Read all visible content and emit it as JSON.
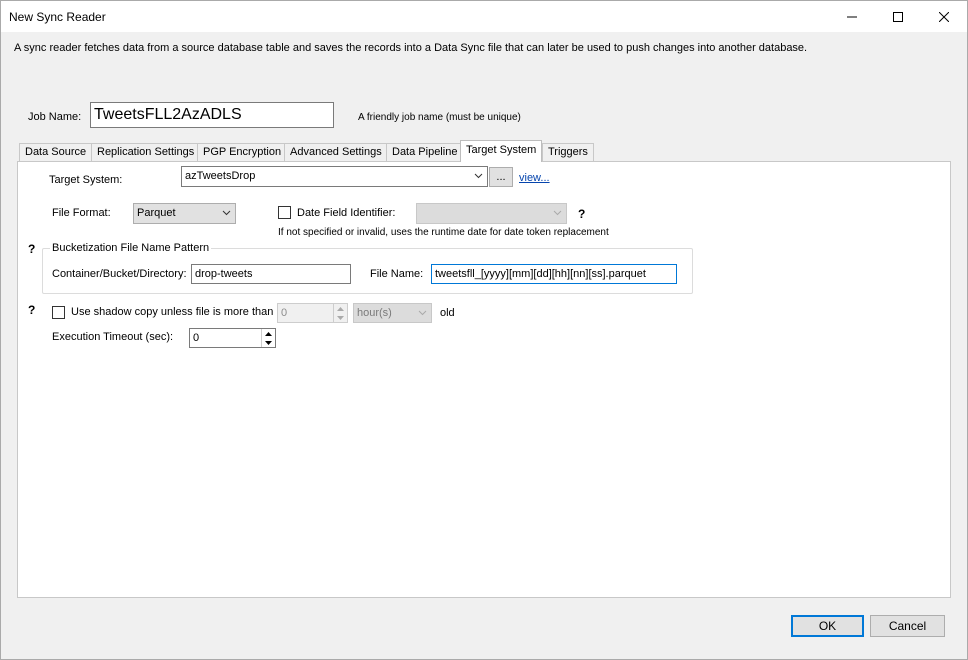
{
  "window": {
    "title": "New Sync Reader"
  },
  "description": "A sync reader fetches data from a source database table and saves the records into a Data Sync file that can later be used to push changes into another database.",
  "job": {
    "label": "Job Name:",
    "value": "TweetsFLL2AzADLS",
    "hint": "A friendly job name (must be unique)"
  },
  "tabs": [
    "Data Source",
    "Replication Settings",
    "PGP Encryption",
    "Advanced Settings",
    "Data Pipeline",
    "Target System",
    "Triggers"
  ],
  "target": {
    "label": "Target System:",
    "value": "azTweetsDrop",
    "browse_label": "...",
    "view_label": "view..."
  },
  "file_format": {
    "label": "File Format:",
    "value": "Parquet"
  },
  "date_field": {
    "label": "Date Field Identifier:",
    "value": "",
    "help": "?",
    "note": "If not specified or invalid, uses the runtime date for date token replacement"
  },
  "bucket": {
    "help": "?",
    "group_title": "Bucketization File Name Pattern",
    "container_label": "Container/Bucket/Directory:",
    "container_value": "drop-tweets",
    "filename_label": "File Name:",
    "filename_value": "tweetsfll_[yyyy][mm][dd][hh][nn][ss].parquet"
  },
  "shadow": {
    "help": "?",
    "label": "Use shadow copy unless file is more than",
    "value": "0",
    "unit": "hour(s)",
    "suffix": "old"
  },
  "timeout": {
    "label": "Execution Timeout (sec):",
    "value": "0"
  },
  "buttons": {
    "ok": "OK",
    "cancel": "Cancel"
  },
  "colors": {
    "accent": "#0078d7",
    "link": "#0645ad",
    "panel": "#ffffff",
    "window_bg": "#f0f0f0"
  }
}
